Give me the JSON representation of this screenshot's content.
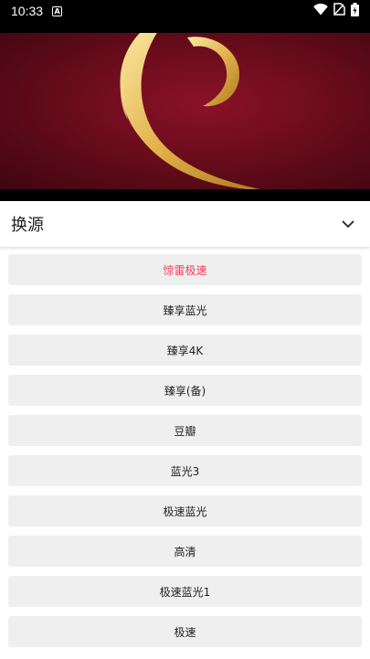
{
  "status_bar": {
    "time": "10:33",
    "notification_glyph": "A",
    "icons": [
      "wifi-icon",
      "no-sim-icon",
      "battery-charging-icon"
    ]
  },
  "player": {
    "content": "golden swirl logo on dark red background"
  },
  "source_panel": {
    "title": "换源",
    "toggle_icon": "chevron-down-icon",
    "active_color": "#f0405a",
    "sources": [
      {
        "label": "惊雷极速",
        "active": true
      },
      {
        "label": "臻享蓝光",
        "active": false
      },
      {
        "label": "臻享4K",
        "active": false
      },
      {
        "label": "臻享(备)",
        "active": false
      },
      {
        "label": "豆瓣",
        "active": false
      },
      {
        "label": "蓝光3",
        "active": false
      },
      {
        "label": "极速蓝光",
        "active": false
      },
      {
        "label": "高清",
        "active": false
      },
      {
        "label": "极速蓝光1",
        "active": false
      },
      {
        "label": "极速",
        "active": false
      }
    ]
  }
}
